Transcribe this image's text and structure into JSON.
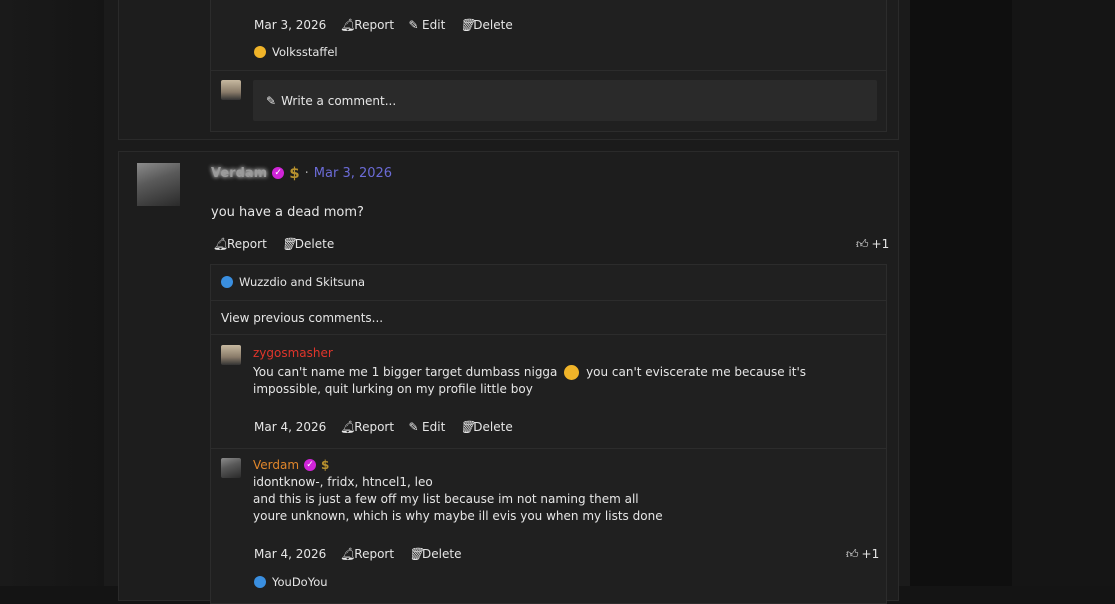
{
  "post1": {
    "comment_date": "Mar 3, 2026",
    "report": "Report",
    "edit": "Edit",
    "delete": "Delete",
    "reaction_user": "Volksstaffel",
    "write_comment": "Write a comment..."
  },
  "post2": {
    "author": "Verdam",
    "separator": "·",
    "date": "Mar 3, 2026",
    "body": "you have a dead mom?",
    "report": "Report",
    "delete": "Delete",
    "likes": "+1",
    "reactions_by": "Wuzzdio and Skitsuna",
    "view_previous": "View previous comments...",
    "comments": [
      {
        "author": "zygosmasher",
        "author_color": "#e0352b",
        "text_before": "You can't name me 1 bigger target dumbass nigga",
        "text_after": "you can't eviscerate me because it's impossible, quit lurking on my profile little boy",
        "date": "Mar 4, 2026",
        "report": "Report",
        "edit": "Edit",
        "delete": "Delete"
      },
      {
        "author": "Verdam",
        "author_color": "#e0862b",
        "line1": "idontknow-, fridx, htncel1, leo",
        "line2": "and this is just a few off my list because im not naming them all",
        "line3": "youre unknown, which is why maybe ill evis you when my lists done",
        "date": "Mar 4, 2026",
        "report": "Report",
        "delete": "Delete",
        "likes": "+1",
        "reaction_user": "YouDoYou"
      }
    ]
  },
  "colors": {
    "date_link": "#6b6bd6",
    "verified_badge": "#d024d8",
    "money": "#b8912e",
    "like_blue": "#3a8fe0"
  }
}
